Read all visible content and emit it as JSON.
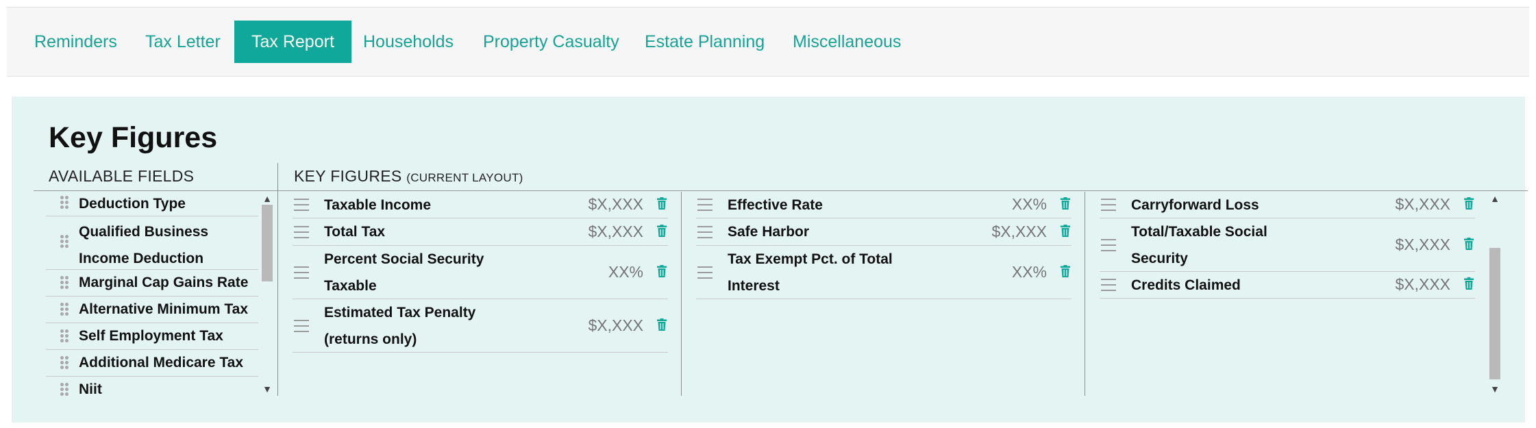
{
  "tabs": [
    {
      "label": "Reminders"
    },
    {
      "label": "Tax Letter"
    },
    {
      "label": "Tax Report"
    },
    {
      "label": "Households"
    },
    {
      "label": "Property Casualty"
    },
    {
      "label": "Estate Planning"
    },
    {
      "label": "Miscellaneous"
    }
  ],
  "active_tab": "Tax Report",
  "panel": {
    "title": "Key Figures",
    "available_header": "AVAILABLE FIELDS",
    "key_figures_header": "KEY FIGURES",
    "key_figures_subheader": "(CURRENT LAYOUT)"
  },
  "available_fields": [
    {
      "line1": "Deduction Type",
      "line2": ""
    },
    {
      "line1": "Qualified Business",
      "line2": "Income Deduction"
    },
    {
      "line1": "Marginal Cap Gains Rate",
      "line2": ""
    },
    {
      "line1": "Alternative Minimum Tax",
      "line2": ""
    },
    {
      "line1": "Self Employment Tax",
      "line2": ""
    },
    {
      "line1": "Additional Medicare Tax",
      "line2": ""
    },
    {
      "line1": "Niit",
      "line2": ""
    }
  ],
  "key_figures": {
    "column1": [
      {
        "line1": "Taxable Income",
        "line2": "",
        "value": "$X,XXX"
      },
      {
        "line1": "Total Tax",
        "line2": "",
        "value": "$X,XXX"
      },
      {
        "line1": "Percent Social Security",
        "line2": "Taxable",
        "value": "XX%"
      },
      {
        "line1": "Estimated Tax Penalty",
        "line2": "(returns only)",
        "value": "$X,XXX"
      }
    ],
    "column2": [
      {
        "line1": "Effective Rate",
        "line2": "",
        "value": "XX%"
      },
      {
        "line1": "Safe Harbor",
        "line2": "",
        "value": "$X,XXX"
      },
      {
        "line1": "Tax Exempt Pct. of Total",
        "line2": "Interest",
        "value": "XX%"
      }
    ],
    "column3": [
      {
        "line1": "Carryforward Loss",
        "line2": "",
        "value": "$X,XXX"
      },
      {
        "line1": "Total/Taxable Social",
        "line2": "Security",
        "value": "$X,XXX"
      },
      {
        "line1": "Credits Claimed",
        "line2": "",
        "value": "$X,XXX"
      }
    ]
  },
  "icons": {
    "drag_grip": "grip-icon",
    "drag_handle": "drag-handle-icon",
    "delete": "trash-icon",
    "scroll_up": "▲",
    "scroll_down": "▼"
  },
  "colors": {
    "accent": "#0fa89a",
    "tab_text": "#16a396",
    "panel_bg": "#e4f4f3",
    "value_text": "#757575"
  }
}
